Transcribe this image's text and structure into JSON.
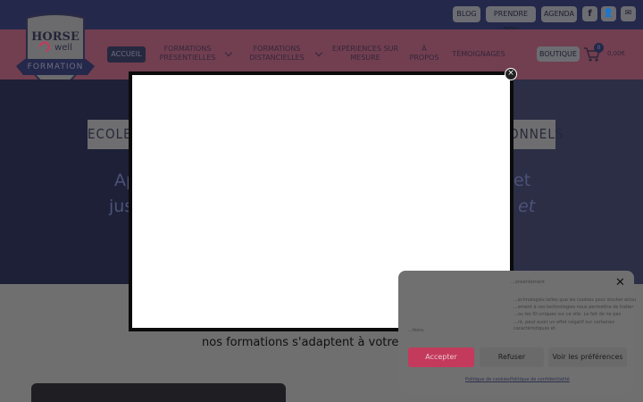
{
  "topbar": {
    "buttons": [
      "BLOG",
      "PRENDRE RDV",
      "AGENDA"
    ],
    "social_icons": [
      "facebook-icon",
      "user-icon",
      "mail-icon"
    ],
    "social_glyphs": [
      "f",
      "👤",
      "✉"
    ]
  },
  "logo": {
    "line1": "HORSE",
    "line2": "well",
    "line3": "FORMATION"
  },
  "nav": {
    "accueil": "ACCUEIL",
    "formations_presentielles": [
      "FORMATIONS",
      "PRÉSENTIELLES"
    ],
    "formations_distancielles": [
      "FORMATIONS",
      "DISTANCIELLES"
    ],
    "experiences": [
      "EXPÉRIENCES SUR",
      "MESURE"
    ],
    "a_propos": [
      "À",
      "PROPOS"
    ],
    "temoignages": "TÉMOIGNAGES",
    "boutique": "BOUTIQUE",
    "cart_count": "0",
    "cart_total": "0,00€"
  },
  "hero": {
    "box_left": "ECOLE",
    "box_right": "ONNELS",
    "line1_left": "Ap",
    "line1_right": "et",
    "line2_left": "jus",
    "line2_right": "et"
  },
  "tagline": "nos formations s'adaptent à votre",
  "modal": {
    "close": "×"
  },
  "cookie": {
    "header": "...onsentement",
    "close": "✕",
    "body_lines": [
      "...echnologies telles que les cookies pour stocker et/ou",
      "...ement à ces technologies nous permettra de traiter",
      "...ou les ID uniques sur ce site. Le fait de ne pas",
      "...nt, peut avoir un effet négatif sur certaines caractéristiques et",
      "...tions."
    ],
    "accept": "Accepter",
    "refuse": "Refuser",
    "prefs": "Voir les préférences",
    "link1": "Politique de cookies",
    "link2": "Politique de confidentialité"
  },
  "colors": {
    "accent": "#c43a5c",
    "navy": "#24284a",
    "pink": "#e76f94"
  }
}
